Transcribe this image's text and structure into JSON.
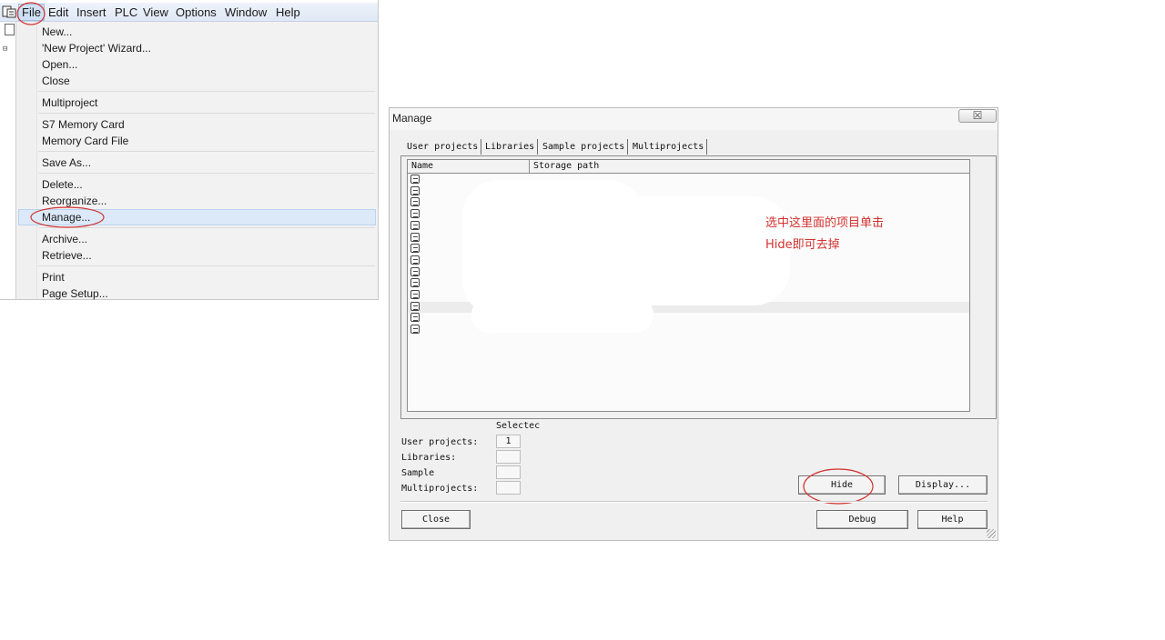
{
  "menu_window": {
    "menubar": [
      "File",
      "Edit",
      "Insert",
      "PLC",
      "View",
      "Options",
      "Window",
      "Help"
    ],
    "tree_glyph": "⊟",
    "file_menu": {
      "groups": [
        [
          "New...",
          "'New Project' Wizard...",
          "Open...",
          "Close"
        ],
        [
          "Multiproject"
        ],
        [
          "S7 Memory Card",
          "Memory Card File"
        ],
        [
          "Save As..."
        ],
        [
          "Delete...",
          "Reorganize...",
          "Manage..."
        ],
        [
          "Archive...",
          "Retrieve..."
        ],
        [
          "Print",
          "Page Setup..."
        ]
      ],
      "highlighted": "Manage..."
    }
  },
  "dialog": {
    "title": "Manage",
    "close_glyph": "☒",
    "tabs": [
      "User projects",
      "Libraries",
      "Sample projects",
      "Multiprojects"
    ],
    "active_tab": "User projects",
    "columns": [
      "Name",
      "Storage path"
    ],
    "row_count": 14,
    "selected_row": 11,
    "annotation_lines": [
      "选中这里面的项目单击",
      "Hide即可去掉"
    ],
    "selected_header": "Selectec",
    "counts": [
      {
        "label": "User projects:",
        "value": "1"
      },
      {
        "label": "Libraries:",
        "value": ""
      },
      {
        "label": "Sample",
        "value": ""
      },
      {
        "label": "Multiprojects:",
        "value": ""
      }
    ],
    "buttons": {
      "hide": "Hide",
      "display": "Display...",
      "close": "Close",
      "debug": "Debug",
      "help": "Help"
    }
  },
  "colors": {
    "annotation": "#d3332f",
    "dialog_bg": "#f0f0f0",
    "menu_highlight": "#dbe9f9"
  }
}
